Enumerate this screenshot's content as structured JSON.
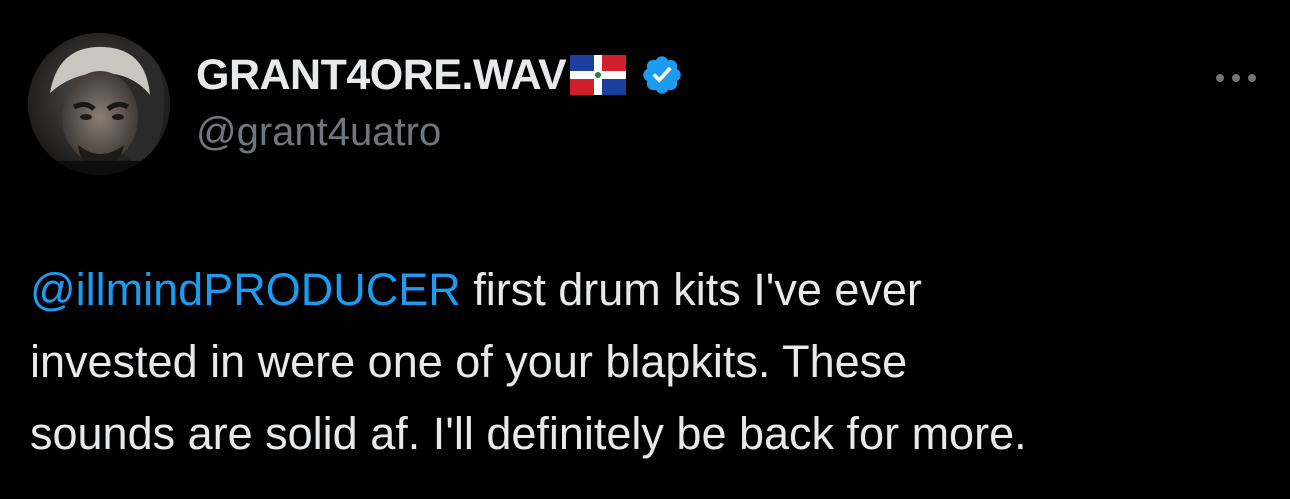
{
  "author": {
    "display_name": "GRANT4ORE.WAV",
    "handle": "@grant4uatro",
    "flag_icon": "dominican-republic-flag-icon",
    "verified_icon": "verified-badge-icon",
    "avatar_icon": "profile-avatar"
  },
  "tweet": {
    "mention": "@illmindPRODUCER",
    "body": " first drum kits I've ever\ninvested in were one of your blapkits. These\nsounds are solid af. I'll definitely be back for more."
  },
  "more_icon": "more-options-icon",
  "colors": {
    "background": "#000000",
    "text": "#e7e9ea",
    "secondary": "#71767b",
    "accent": "#1d9bf0"
  }
}
